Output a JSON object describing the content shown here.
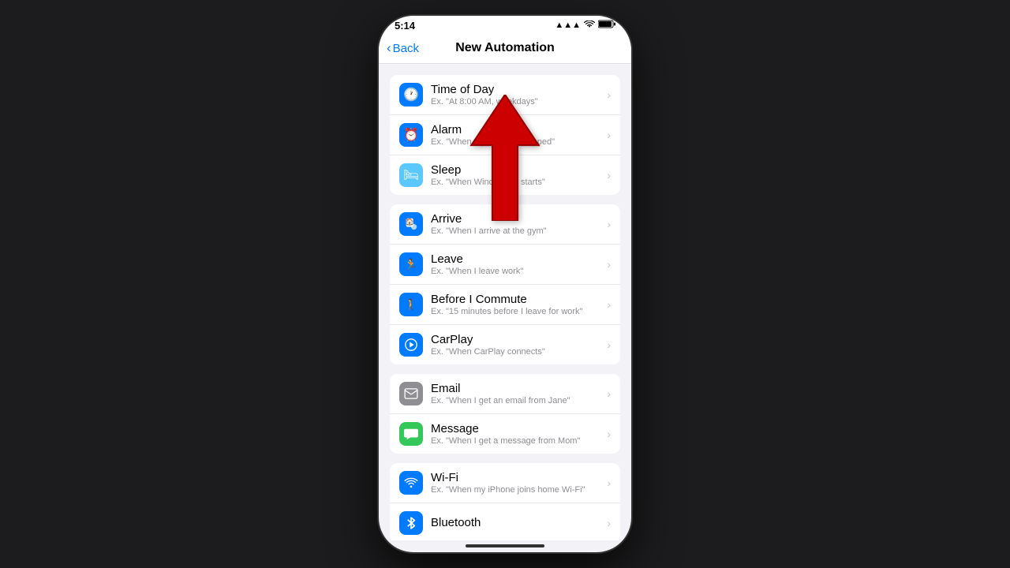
{
  "statusBar": {
    "time": "5:14",
    "signal": "▲▲▲",
    "wifi": "▲",
    "battery": "▓"
  },
  "header": {
    "backLabel": "Back",
    "title": "New Automation"
  },
  "sections": [
    {
      "id": "time-section",
      "items": [
        {
          "id": "time-of-day",
          "title": "Time of Day",
          "subtitle": "Ex. \"At 8:00 AM, weekdays\"",
          "iconColor": "blue",
          "iconType": "clock"
        },
        {
          "id": "alarm",
          "title": "Alarm",
          "subtitle": "Ex. \"When my alarm is stopped\"",
          "iconColor": "blue",
          "iconType": "clock2"
        },
        {
          "id": "sleep",
          "title": "Sleep",
          "subtitle": "Ex. \"When Wind Down starts\"",
          "iconColor": "teal",
          "iconType": "bed"
        }
      ]
    },
    {
      "id": "location-section",
      "items": [
        {
          "id": "arrive",
          "title": "Arrive",
          "subtitle": "Ex. \"When I arrive at the gym\"",
          "iconColor": "blue",
          "iconType": "arrive"
        },
        {
          "id": "leave",
          "title": "Leave",
          "subtitle": "Ex. \"When I leave work\"",
          "iconColor": "blue",
          "iconType": "leave"
        },
        {
          "id": "before-commute",
          "title": "Before I Commute",
          "subtitle": "Ex. \"15 minutes before I leave for work\"",
          "iconColor": "blue",
          "iconType": "commute"
        },
        {
          "id": "carplay",
          "title": "CarPlay",
          "subtitle": "Ex. \"When CarPlay connects\"",
          "iconColor": "blue",
          "iconType": "carplay"
        }
      ]
    },
    {
      "id": "communication-section",
      "items": [
        {
          "id": "email",
          "title": "Email",
          "subtitle": "Ex. \"When I get an email from Jane\"",
          "iconColor": "gray",
          "iconType": "email"
        },
        {
          "id": "message",
          "title": "Message",
          "subtitle": "Ex. \"When I get a message from Mom\"",
          "iconColor": "green",
          "iconType": "message"
        }
      ]
    },
    {
      "id": "connectivity-section",
      "items": [
        {
          "id": "wifi",
          "title": "Wi-Fi",
          "subtitle": "Ex. \"When my iPhone joins home Wi-Fi\"",
          "iconColor": "blue",
          "iconType": "wifi"
        },
        {
          "id": "bluetooth",
          "title": "Bluetooth",
          "subtitle": "",
          "iconColor": "blue",
          "iconType": "bluetooth"
        }
      ]
    }
  ]
}
